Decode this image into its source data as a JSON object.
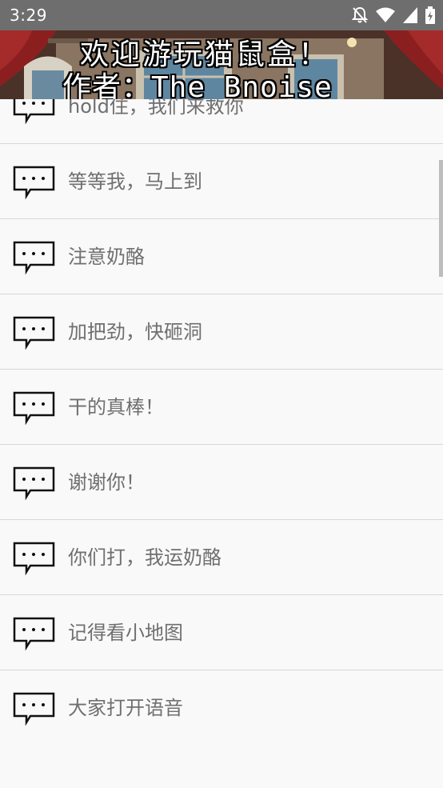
{
  "status_bar": {
    "time": "3:29",
    "icons": [
      "notifications-off-icon",
      "wifi-icon",
      "cell-signal-icon",
      "battery-icon"
    ]
  },
  "banner": {
    "line1": "欢迎游玩猫鼠盒！",
    "line2": "作者：The_Bnoise"
  },
  "phrases": [
    "hold住，我们来救你",
    "等等我，马上到",
    "注意奶酪",
    "加把劲，快砸洞",
    "干的真棒！",
    "谢谢你！",
    "你们打，我运奶酪",
    "记得看小地图",
    "大家打开语音"
  ],
  "colors": {
    "status_bar": "#6e6e6e",
    "background": "#f9f9f9",
    "text": "#6f6f6f",
    "divider": "#d8d8d8"
  }
}
